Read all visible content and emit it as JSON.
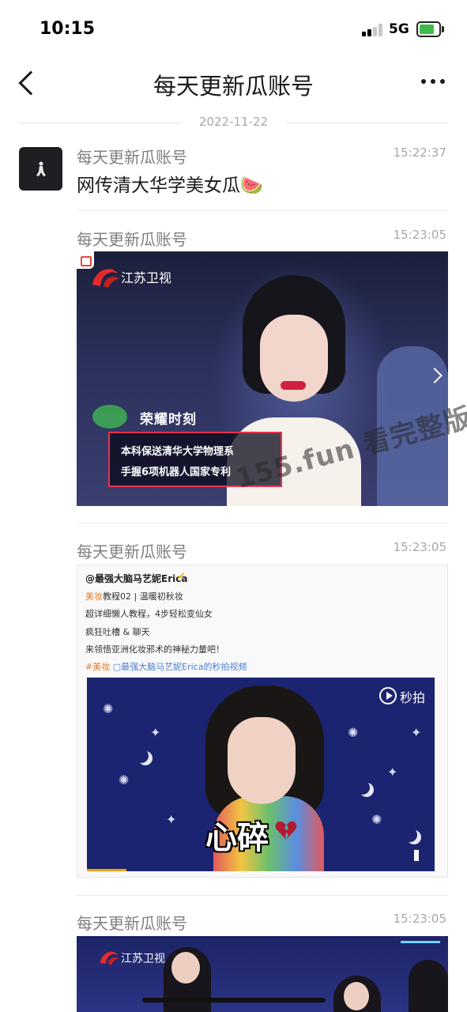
{
  "status_bar": {
    "time": "10:15",
    "network": "5G"
  },
  "nav": {
    "title": "每天更新瓜账号"
  },
  "date_divider": "2022-11-22",
  "messages": [
    {
      "sender": "每天更新瓜账号",
      "time": "15:22:37",
      "text": "网传清大华学美女瓜🍉"
    },
    {
      "sender": "每天更新瓜账号",
      "time": "15:23:05",
      "video": {
        "channel_logo_text": "江苏卫视",
        "tag": "荣耀时刻",
        "line1": "本科保送清华大学物理系",
        "line2": "手握6项机器人国家专利"
      }
    },
    {
      "sender": "每天更新瓜账号",
      "time": "15:23:05",
      "post": {
        "author": "@最强大脑马艺妮Erica",
        "line1_tag": "美妆",
        "line1_rest": "教程02 | 温暖初秋妆",
        "line2": "超详细懒人教程，4步轻松变仙女",
        "line3": "疯狂吐槽 & 聊天",
        "line4": "来领悟亚洲化妆邪术的神秘力量吧！",
        "line5_tag": "#美妆",
        "line5_link": "最强大脑马艺妮Erica的秒拍视频",
        "caption": "心碎",
        "miaopai": "秒拍"
      }
    },
    {
      "sender": "每天更新瓜账号",
      "time": "15:23:05",
      "video": {
        "channel_logo_text": "江苏卫视"
      }
    }
  ],
  "watermark": "155.fun 看完整版",
  "icons": {
    "back": "chevron-left-icon",
    "more": "more-dots-icon",
    "signal": "signal-icon",
    "battery": "battery-charging-icon",
    "next": "chevron-right-icon",
    "play": "play-icon",
    "volume": "volume-icon"
  },
  "colors": {
    "accent_red": "#e7324c",
    "battery_green": "#3dbb4a",
    "tag_orange": "#ee7a1e",
    "link_blue": "#4a7ed3"
  }
}
